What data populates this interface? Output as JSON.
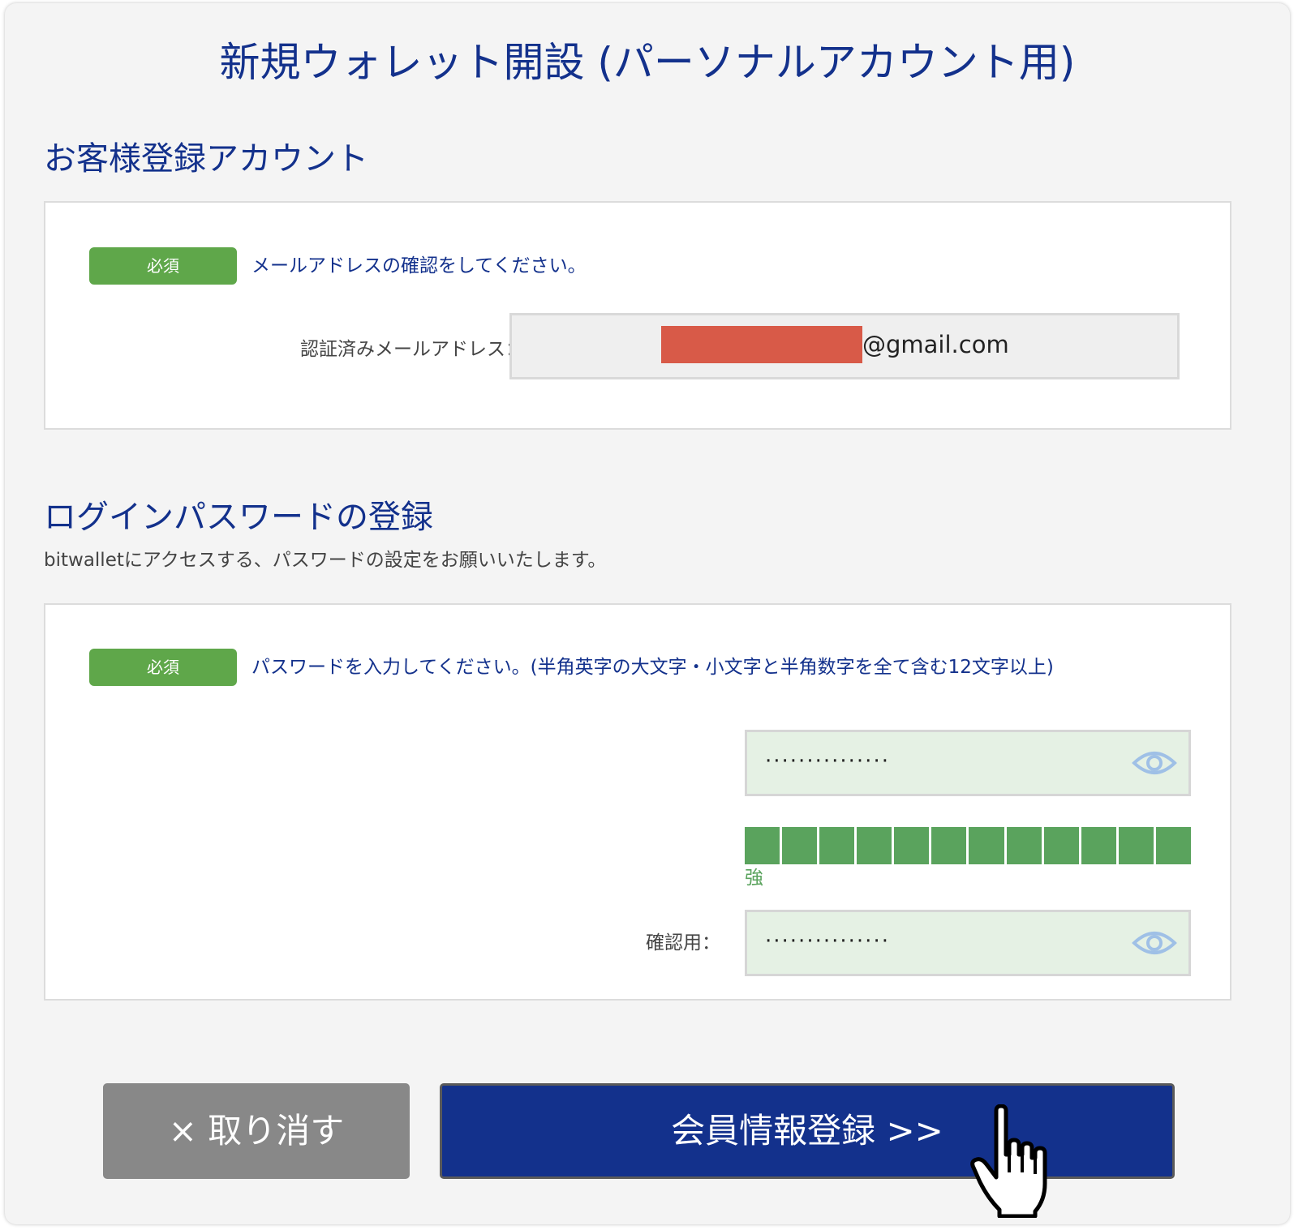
{
  "page": {
    "title": "新規ウォレット開設 (パーソナルアカウント用)"
  },
  "account_section": {
    "title": "お客様登録アカウント",
    "badge": "必須",
    "instruction": "メールアドレスの確認をしてください。",
    "email_label": "認証済みメールアドレス：",
    "email_domain": "@gmail.com"
  },
  "password_section": {
    "title": "ログインパスワードの登録",
    "description": "bitwalletにアクセスする、パスワードの設定をお願いいたします。",
    "badge": "必須",
    "instruction": "パスワードを入力してください。(半角英字の大文字・小文字と半角数字を全て含む12文字以上)",
    "password_value": "···············",
    "strength": {
      "segments_filled": 12,
      "segments_total": 12,
      "label": "強"
    },
    "confirm_label": "確認用：",
    "confirm_value": "···············"
  },
  "buttons": {
    "cancel": "× 取り消す",
    "submit": "会員情報登録 >>"
  },
  "icons": {
    "eye": "eye-icon",
    "cursor": "hand-pointer-icon"
  },
  "colors": {
    "brand": "#13318c",
    "badge": "#5fa74a",
    "strength": "#5aa35d",
    "cancel": "#888888",
    "redaction": "#d85a48"
  }
}
